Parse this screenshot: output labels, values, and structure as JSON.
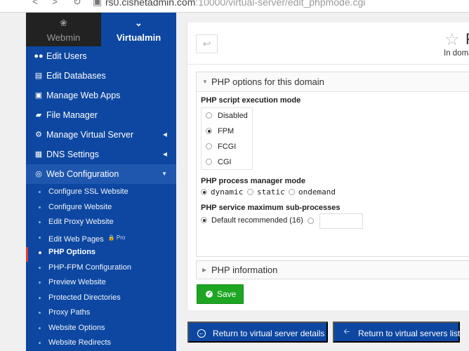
{
  "browser": {
    "url_host": "rs0.cishetadmin.com",
    "url_path": ":10000/virtual-server/edit_phpmode.cgi"
  },
  "switcher": {
    "webmin": "Webmin",
    "virtualmin": "Virtualmin"
  },
  "sidebar": {
    "items": [
      {
        "label": "Edit Users"
      },
      {
        "label": "Edit Databases"
      },
      {
        "label": "Manage Web Apps"
      },
      {
        "label": "File Manager"
      },
      {
        "label": "Manage Virtual Server"
      },
      {
        "label": "DNS Settings"
      },
      {
        "label": "Web Configuration"
      }
    ],
    "subitems": [
      {
        "label": "Configure SSL Website"
      },
      {
        "label": "Configure Website"
      },
      {
        "label": "Edit Proxy Website"
      },
      {
        "label": "Edit Web Pages",
        "badge": "Pro"
      },
      {
        "label": "PHP Options"
      },
      {
        "label": "PHP-FPM Configuration"
      },
      {
        "label": "Preview Website"
      },
      {
        "label": "Protected Directories"
      },
      {
        "label": "Proxy Paths"
      },
      {
        "label": "Website Options"
      },
      {
        "label": "Website Redirects"
      }
    ]
  },
  "header": {
    "title": "P",
    "subtitle": "In doma"
  },
  "panel": {
    "title": "PHP options for this domain",
    "exec_mode_label": "PHP script execution mode",
    "exec_modes": [
      "Disabled",
      "FPM",
      "FCGI",
      "CGI"
    ],
    "exec_mode_selected": "FPM",
    "pm_label": "PHP process manager mode",
    "pm_options": [
      "dynamic",
      "static",
      "ondemand"
    ],
    "pm_selected": "dynamic",
    "subproc_label": "PHP service maximum sub-processes",
    "subproc_default": "Default recommended (16)",
    "subproc_value": ""
  },
  "info_panel": {
    "title": "PHP information"
  },
  "buttons": {
    "save": "Save",
    "return_details": "Return to virtual server details",
    "return_list": "Return to virtual servers list"
  }
}
